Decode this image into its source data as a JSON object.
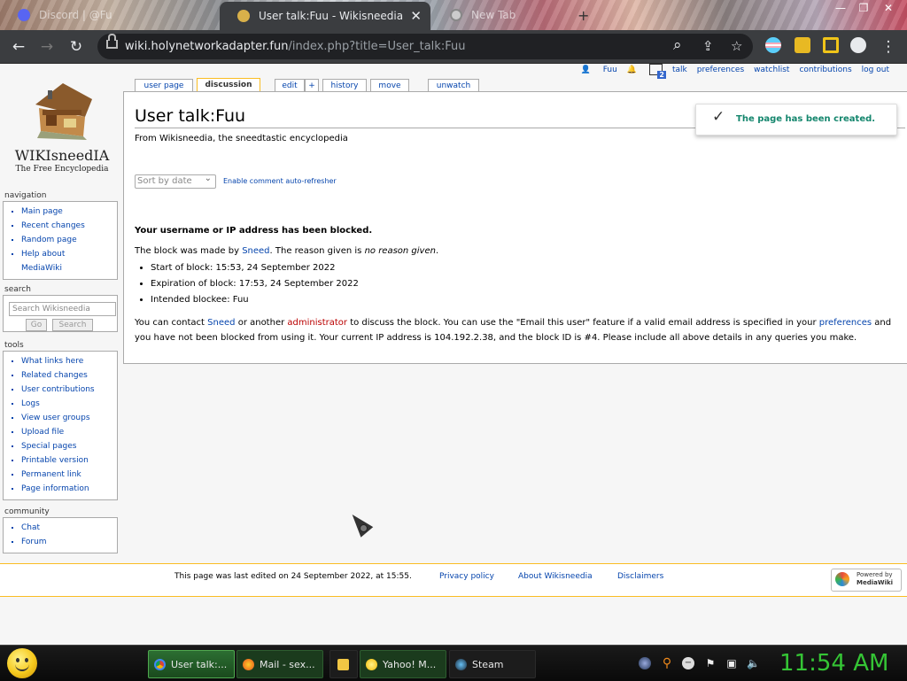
{
  "browser": {
    "tabs": [
      {
        "title": "Discord | @Fu"
      },
      {
        "title": "User talk:Fuu - Wikisneedia",
        "close": "✕"
      },
      {
        "title": "New Tab"
      }
    ],
    "new_tab": "+",
    "window_controls": [
      "—",
      "❐",
      "✕"
    ],
    "url_host": "wiki.holynetworkadapter.fun",
    "url_rest": "/index.php?title=User_talk:Fuu",
    "nav": {
      "back": "←",
      "forward": "→",
      "reload": "↻"
    },
    "icons": {
      "zoom": "⌕",
      "share": "⇪",
      "star": "☆",
      "menu": "⋮"
    }
  },
  "personal": {
    "user": "Fuu",
    "notify_count": "2",
    "links": [
      "talk",
      "preferences",
      "watchlist",
      "contributions",
      "log out"
    ]
  },
  "logo": {
    "wordmark": "WIKIsneedIA",
    "tagline": "The Free Encyclopedia"
  },
  "tabs": {
    "user_page": "user page",
    "discussion": "discussion",
    "edit": "edit",
    "add": "+",
    "history": "history",
    "move": "move",
    "unwatch": "unwatch"
  },
  "sidebar": {
    "navigation_heading": "navigation",
    "navigation": [
      "Main page",
      "Recent changes",
      "Random page",
      "Help about MediaWiki"
    ],
    "search_heading": "search",
    "search_placeholder": "Search Wikisneedia",
    "go": "Go",
    "search_btn": "Search",
    "tools_heading": "tools",
    "tools": [
      "What links here",
      "Related changes",
      "User contributions",
      "Logs",
      "View user groups",
      "Upload file",
      "Special pages",
      "Printable version",
      "Permanent link",
      "Page information"
    ],
    "community_heading": "community",
    "community": [
      "Chat",
      "Forum"
    ]
  },
  "content": {
    "title": "User talk:Fuu",
    "site_sub": "From Wikisneedia, the sneedtastic encyclopedia",
    "sort_select": "Sort by date",
    "refresher": "Enable comment auto-refresher",
    "blocked_heading": "Your username or IP address has been blocked.",
    "made_by_pre": "The block was made by ",
    "made_by_user": "Sneed",
    "made_by_mid": ". The reason given is ",
    "reason": "no reason given",
    "made_by_end": ".",
    "block_items": [
      "Start of block: 15:53, 24 September 2022",
      "Expiration of block: 17:53, 24 September 2022",
      "Intended blockee: Fuu"
    ],
    "contact_1": "You can contact ",
    "contact_sneed": "Sneed",
    "contact_2": " or another ",
    "contact_admin": "administrator",
    "contact_3": " to discuss the block. You can use the \"Email this user\" feature if a valid email address is specified in your ",
    "contact_prefs": "preferences",
    "contact_4": " and you have not been blocked from using it. Your current IP address is 104.192.2.38, and the block ID is #4. Please include all above details in any queries you make."
  },
  "notification": {
    "icon": "✓",
    "message": "The page has been created."
  },
  "footer": {
    "last_edited": "This page was last edited on 24 September 2022, at 15:55.",
    "privacy": "Privacy policy",
    "about": "About Wikisneedia",
    "disclaimers": "Disclaimers",
    "powered_1": "Powered by",
    "powered_2": "MediaWiki"
  },
  "taskbar": {
    "tasks": [
      "User talk:...",
      "Mail - sex...",
      "",
      "Yahoo! M...",
      "Steam"
    ],
    "clock": "11:54 AM"
  },
  "colors": {
    "link": "#0645ad",
    "accent": "#fabd23",
    "success": "#14866d",
    "clock": "#35c535"
  }
}
